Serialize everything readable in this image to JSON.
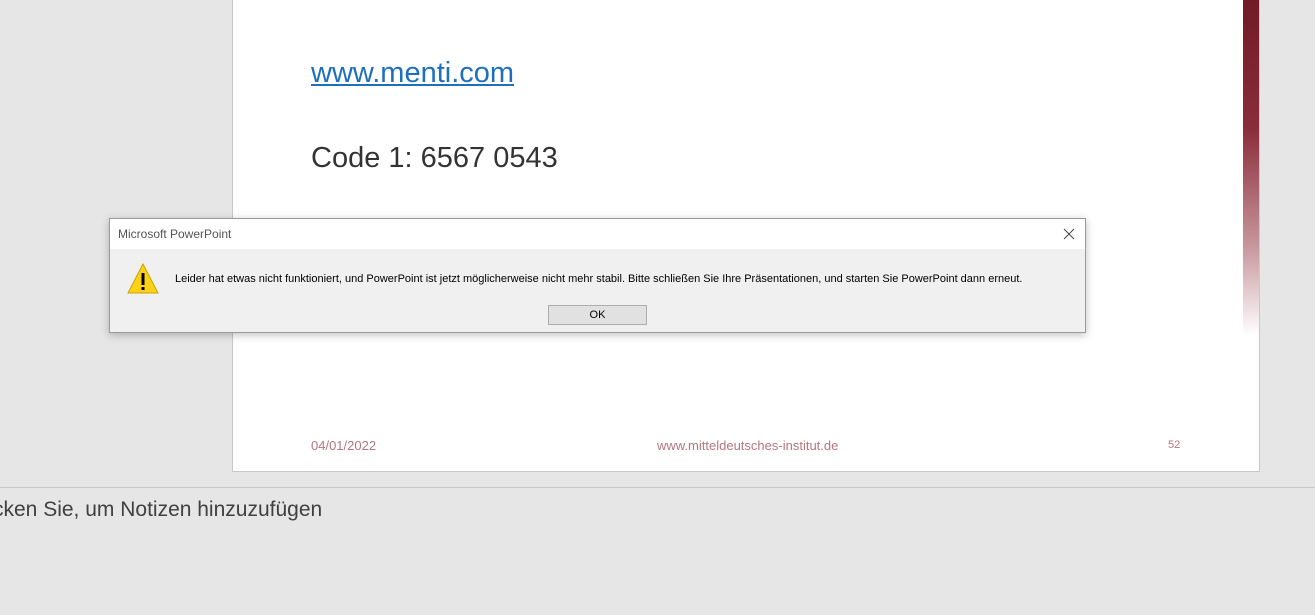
{
  "slide": {
    "link_text": "www.menti.com",
    "code_text": "Code 1: 6567 0543",
    "footer": {
      "date": "04/01/2022",
      "url": "www.mitteldeutsches-institut.de",
      "page_number": "52"
    }
  },
  "notes": {
    "placeholder": "cken Sie, um Notizen hinzuzufügen"
  },
  "dialog": {
    "title": "Microsoft PowerPoint",
    "message": "Leider hat etwas nicht funktioniert, und PowerPoint ist jetzt möglicherweise nicht mehr stabil. Bitte schließen Sie Ihre Präsentationen, und starten Sie PowerPoint dann erneut.",
    "ok_label": "OK",
    "icons": {
      "warning": "warning-icon",
      "close": "close-icon"
    }
  },
  "colors": {
    "slide_accent": "#6e1a25",
    "title_red": "#9c1b30",
    "link_blue": "#1f6fbf",
    "footer_text": "#b5767f",
    "warning_yellow": "#fcd116"
  }
}
